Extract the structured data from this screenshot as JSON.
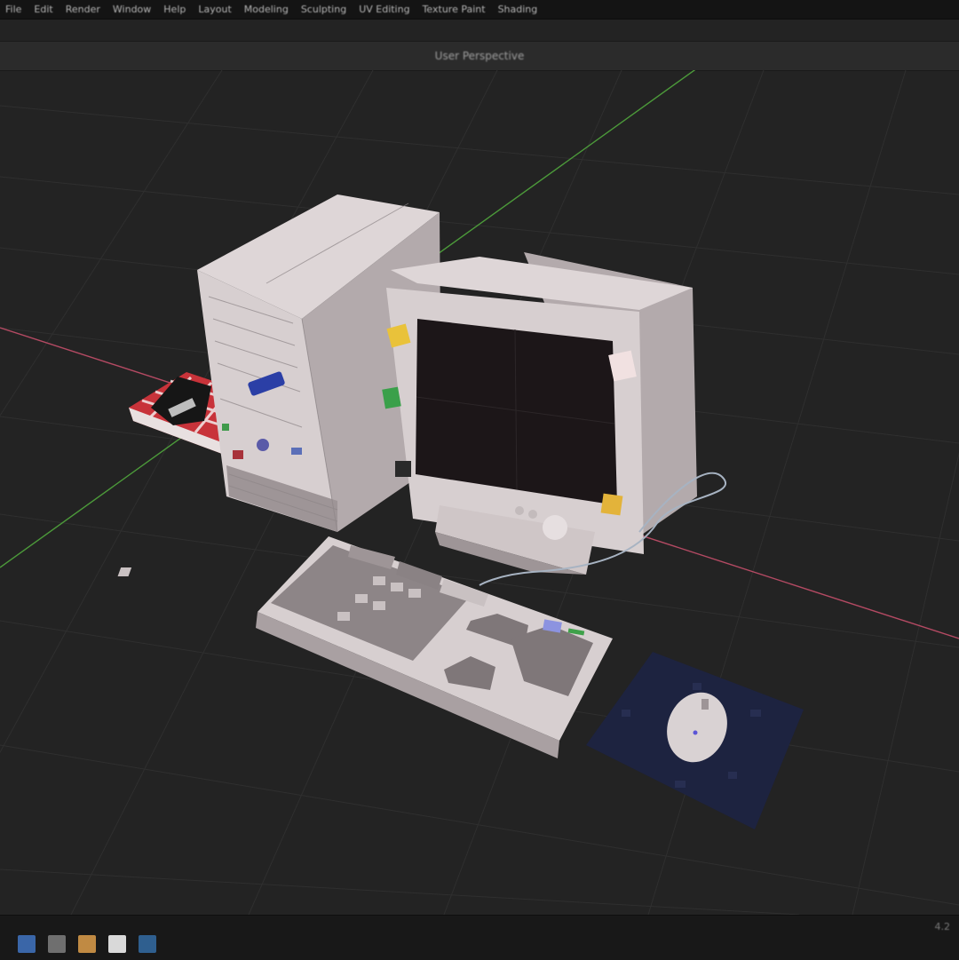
{
  "menubar": {
    "items": [
      "File",
      "Edit",
      "Render",
      "Window",
      "Help",
      "Layout",
      "Modeling",
      "Sculpting",
      "UV Editing",
      "Texture Paint",
      "Shading"
    ]
  },
  "header": {
    "title": "User Perspective"
  },
  "status": {
    "text": "4.2"
  },
  "taskbar": {
    "icons": [
      {
        "name": "app-icon-1",
        "color": "#3a66a8"
      },
      {
        "name": "app-icon-2",
        "color": "#6f6f6f"
      },
      {
        "name": "app-icon-3",
        "color": "#c08a43"
      },
      {
        "name": "app-icon-4",
        "color": "#d9d9d9"
      },
      {
        "name": "app-icon-5",
        "color": "#2f5f8f"
      }
    ]
  },
  "colors": {
    "grid_line": "#2f2f2f",
    "x_axis": "#b44a63",
    "y_axis": "#4c9a3a",
    "plastic": "#d7cfd0",
    "plastic_shade": "#b3aaac",
    "screen": "#1c1618",
    "mousepad": "#1d2340",
    "checker_red": "#c8333a"
  }
}
